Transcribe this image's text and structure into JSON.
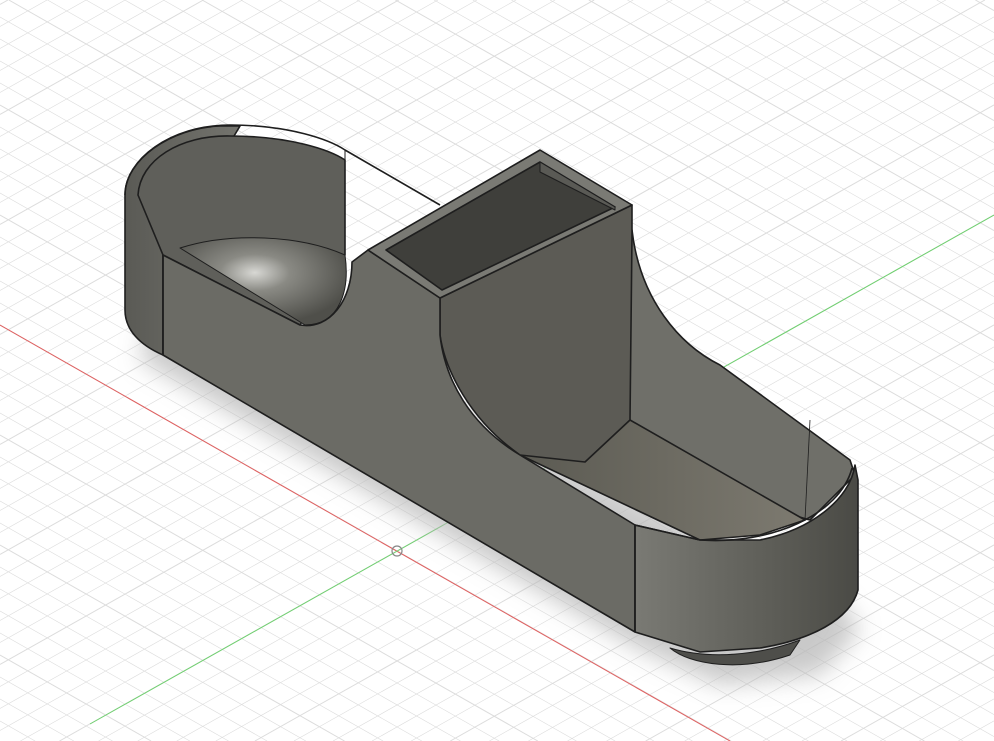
{
  "viewport": {
    "background": "#ffffff",
    "grid_color": "#dcdcdc",
    "x_axis_color": "#e06060",
    "y_axis_color": "#6fd06f",
    "model_color": "#6a6a64",
    "edge_color": "#1e1e1e"
  }
}
